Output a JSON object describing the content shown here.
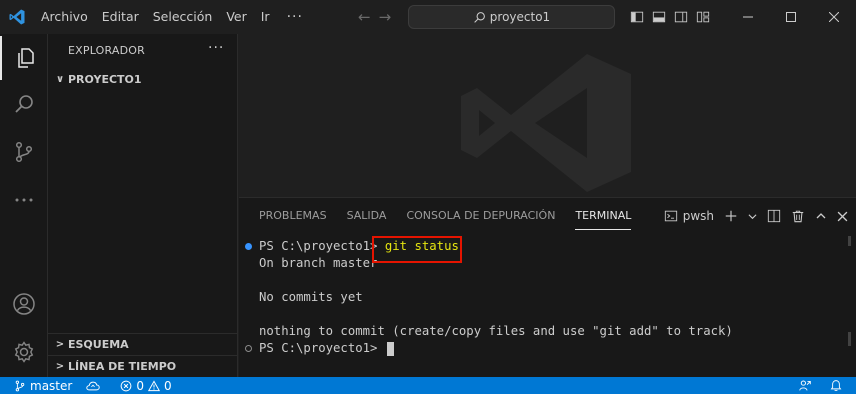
{
  "menu": {
    "items": [
      "Archivo",
      "Editar",
      "Selección",
      "Ver",
      "Ir"
    ],
    "more": "···"
  },
  "search": {
    "text": "proyecto1"
  },
  "sidebar": {
    "title": "EXPLORADOR",
    "more": "···",
    "project": "PROYECTO1",
    "outline": "ESQUEMA",
    "timeline": "LÍNEA DE TIEMPO"
  },
  "panel": {
    "tabs": [
      "PROBLEMAS",
      "SALIDA",
      "CONSOLA DE DEPURACIÓN",
      "TERMINAL"
    ],
    "active_tab": "TERMINAL",
    "shell": "pwsh"
  },
  "terminal": {
    "prompt1": "PS C:\\proyecto1> ",
    "command": "git status",
    "line2": "On branch master",
    "line3": "No commits yet",
    "line4": "nothing to commit (create/copy files and use \"git add\" to track)",
    "prompt2": "PS C:\\proyecto1> "
  },
  "status": {
    "branch": "master",
    "errors": "0",
    "warnings": "0"
  },
  "colors": {
    "accent": "#0078d4",
    "highlight": "#e51400",
    "command": "#e5e510"
  }
}
